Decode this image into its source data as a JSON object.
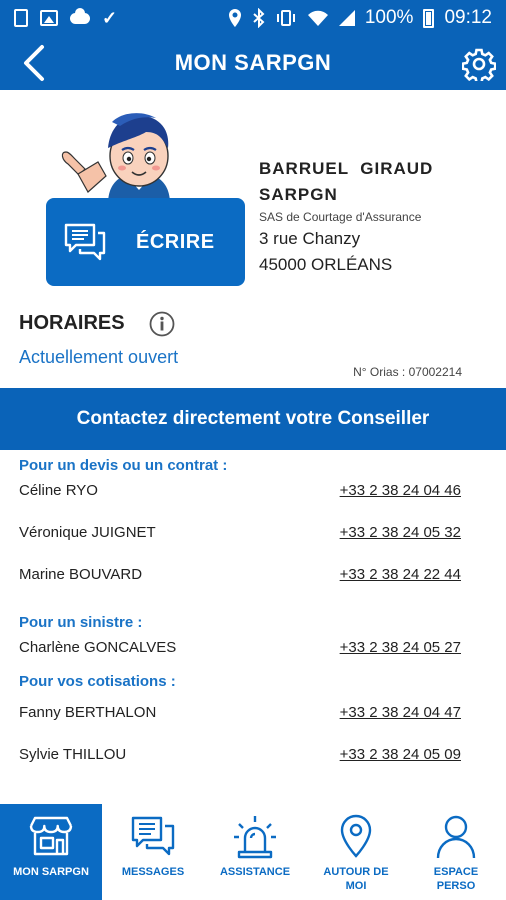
{
  "status_bar": {
    "battery": "100%",
    "time": "09:12"
  },
  "header": {
    "title": "MON SARPGN"
  },
  "profile": {
    "write_label": "ÉCRIRE",
    "agency_name_1": "BARRUEL  GIRAUD",
    "agency_name_2": "SARPGN",
    "agency_type": "SAS de Courtage d'Assurance",
    "address_1": "3 rue Chanzy",
    "address_2": "45000 ORLÉANS"
  },
  "hours": {
    "title": "HORAIRES",
    "status": "Actuellement ouvert",
    "orias": "N° Orias : 07002214"
  },
  "contact": {
    "banner": "Contactez directement votre Conseiller",
    "sections": [
      {
        "title": "Pour un devis ou un contrat :",
        "contacts": [
          {
            "name": "Céline RYO",
            "phone": "+33 2 38 24 04 46"
          },
          {
            "name": "Véronique JUIGNET",
            "phone": "+33 2 38 24 05 32"
          },
          {
            "name": "Marine BOUVARD",
            "phone": "+33 2 38 24 22 44"
          }
        ]
      },
      {
        "title": "Pour un sinistre :",
        "contacts": [
          {
            "name": "Charlène GONCALVES",
            "phone": "+33 2 38 24 05 27"
          }
        ]
      },
      {
        "title": "Pour vos cotisations :",
        "contacts": [
          {
            "name": "Fanny BERTHALON",
            "phone": "+33 2 38 24 04 47"
          },
          {
            "name": "Sylvie THILLOU",
            "phone": "+33 2 38 24 05 09"
          }
        ]
      }
    ]
  },
  "nav": {
    "items": [
      {
        "label": "MON SARPGN",
        "icon": "store-icon",
        "active": true
      },
      {
        "label": "MESSAGES",
        "icon": "messages-icon",
        "active": false
      },
      {
        "label": "ASSISTANCE",
        "icon": "alarm-light-icon",
        "active": false
      },
      {
        "label_1": "AUTOUR DE",
        "label_2": "MOI",
        "icon": "location-pin-icon",
        "active": false
      },
      {
        "label_1": "ESPACE",
        "label_2": "PERSO",
        "icon": "user-icon",
        "active": false
      }
    ]
  },
  "colors": {
    "primary": "#0a63b8",
    "link": "#1a73c6"
  }
}
